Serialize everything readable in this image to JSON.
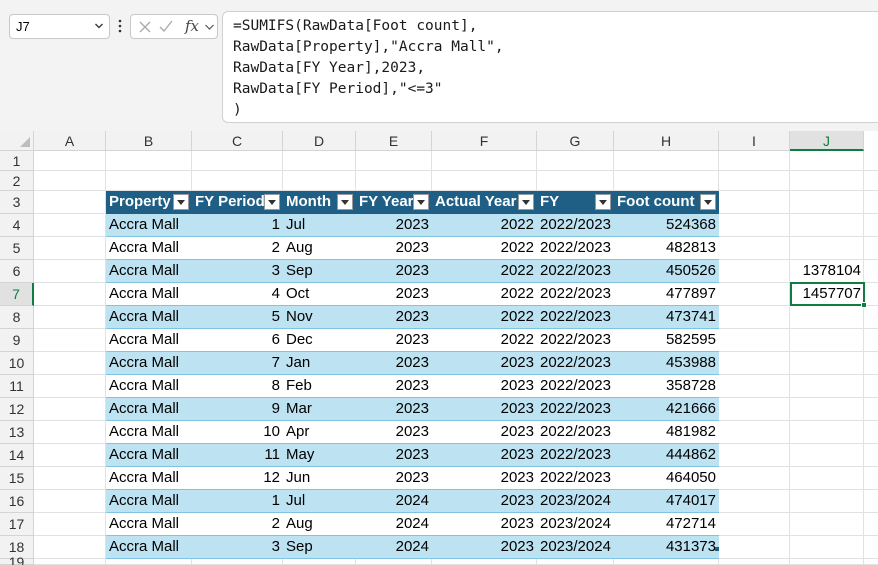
{
  "name_box": {
    "value": "J7"
  },
  "formula_bar": {
    "fx_label": "fx",
    "formula": "=SUMIFS(RawData[Foot count],\nRawData[Property],\"Accra Mall\",\nRawData[FY Year],2023,\nRawData[FY Period],\"<=3\"\n)"
  },
  "column_headers": [
    "A",
    "B",
    "C",
    "D",
    "E",
    "F",
    "G",
    "H",
    "I",
    "J"
  ],
  "active_column": "J",
  "row_headers": [
    "1",
    "2",
    "3",
    "4",
    "5",
    "6",
    "7",
    "8",
    "9",
    "10",
    "11",
    "12",
    "13",
    "14",
    "15",
    "16",
    "17",
    "18",
    "19"
  ],
  "active_row": "7",
  "table": {
    "name": "RawData",
    "headers": [
      "Property",
      "FY Period",
      "Month",
      "FY Year",
      "Actual Year",
      "FY",
      "Foot count"
    ],
    "rows": [
      [
        "Accra Mall",
        "1",
        "Jul",
        "2023",
        "2022",
        "2022/2023",
        "524368"
      ],
      [
        "Accra Mall",
        "2",
        "Aug",
        "2023",
        "2022",
        "2022/2023",
        "482813"
      ],
      [
        "Accra Mall",
        "3",
        "Sep",
        "2023",
        "2022",
        "2022/2023",
        "450526"
      ],
      [
        "Accra Mall",
        "4",
        "Oct",
        "2023",
        "2022",
        "2022/2023",
        "477897"
      ],
      [
        "Accra Mall",
        "5",
        "Nov",
        "2023",
        "2022",
        "2022/2023",
        "473741"
      ],
      [
        "Accra Mall",
        "6",
        "Dec",
        "2023",
        "2022",
        "2022/2023",
        "582595"
      ],
      [
        "Accra Mall",
        "7",
        "Jan",
        "2023",
        "2023",
        "2022/2023",
        "453988"
      ],
      [
        "Accra Mall",
        "8",
        "Feb",
        "2023",
        "2023",
        "2022/2023",
        "358728"
      ],
      [
        "Accra Mall",
        "9",
        "Mar",
        "2023",
        "2023",
        "2022/2023",
        "421666"
      ],
      [
        "Accra Mall",
        "10",
        "Apr",
        "2023",
        "2023",
        "2022/2023",
        "481982"
      ],
      [
        "Accra Mall",
        "11",
        "May",
        "2023",
        "2023",
        "2022/2023",
        "444862"
      ],
      [
        "Accra Mall",
        "12",
        "Jun",
        "2023",
        "2023",
        "2022/2023",
        "464050"
      ],
      [
        "Accra Mall",
        "1",
        "Jul",
        "2024",
        "2023",
        "2023/2024",
        "474017"
      ],
      [
        "Accra Mall",
        "2",
        "Aug",
        "2024",
        "2023",
        "2023/2024",
        "472714"
      ],
      [
        "Accra Mall",
        "3",
        "Sep",
        "2024",
        "2023",
        "2023/2024",
        "431373"
      ]
    ]
  },
  "cells": {
    "J6": "1378104",
    "J7": "1457707"
  },
  "colors": {
    "table_header": "#1f5f86",
    "band": "#bde2f2",
    "selection": "#107c41"
  }
}
